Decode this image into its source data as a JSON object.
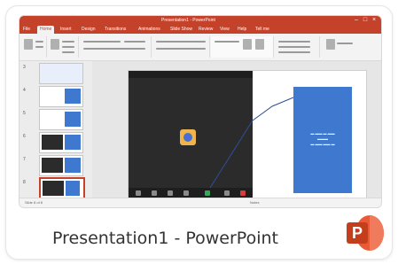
{
  "window_title": "Presentation1 - PowerPoint",
  "colors": {
    "accent": "#c4412a",
    "slide_blue": "#3f79cf",
    "video_bg": "#2b2b2b",
    "app_icon": "#c43e1c"
  },
  "thumbnail": {
    "titlebar_text": "Presentation1 - PowerPoint",
    "tabs": [
      "File",
      "Home",
      "Insert",
      "Design",
      "Transitions",
      "Animations",
      "Slide Show",
      "Review",
      "View",
      "Help",
      "Tell me"
    ],
    "active_tab": "Home",
    "slide_numbers": [
      "3",
      "4",
      "5",
      "6",
      "7",
      "8"
    ],
    "status_left": "Slide 8 of 8",
    "status_right": "Notes"
  },
  "app_icon": {
    "name": "powerpoint-icon",
    "letter": "P"
  }
}
